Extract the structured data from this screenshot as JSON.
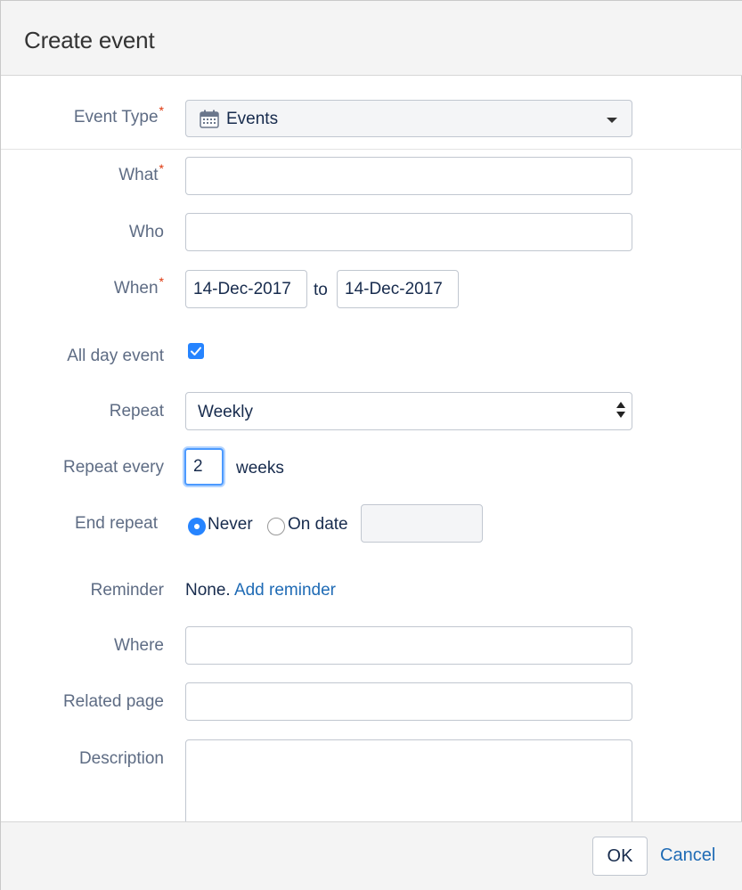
{
  "dialog": {
    "title": "Create event"
  },
  "form": {
    "event_type": {
      "label": "Event Type",
      "required_mark": "*",
      "value": "Events",
      "icon": "calendar-icon"
    },
    "what": {
      "label": "What",
      "required_mark": "*",
      "value": ""
    },
    "who": {
      "label": "Who",
      "value": ""
    },
    "when": {
      "label": "When",
      "required_mark": "*",
      "start": "14-Dec-2017",
      "separator": "to",
      "end": "14-Dec-2017"
    },
    "all_day": {
      "label": "All day event",
      "checked": true
    },
    "repeat": {
      "label": "Repeat",
      "value": "Weekly"
    },
    "repeat_every": {
      "label": "Repeat every",
      "value": "2",
      "unit": "weeks"
    },
    "end_repeat": {
      "label": "End repeat",
      "option_never": "Never",
      "option_on_date": "On date",
      "selected": "Never",
      "date_value": ""
    },
    "reminder": {
      "label": "Reminder",
      "value": "None.",
      "link": "Add reminder"
    },
    "where": {
      "label": "Where",
      "value": ""
    },
    "related_page": {
      "label": "Related page",
      "value": ""
    },
    "description": {
      "label": "Description",
      "value": ""
    }
  },
  "footer": {
    "ok_label": "OK",
    "cancel_label": "Cancel"
  },
  "colors": {
    "accent": "#1f6bb5",
    "required": "#de350b",
    "checkbox": "#2684ff"
  }
}
